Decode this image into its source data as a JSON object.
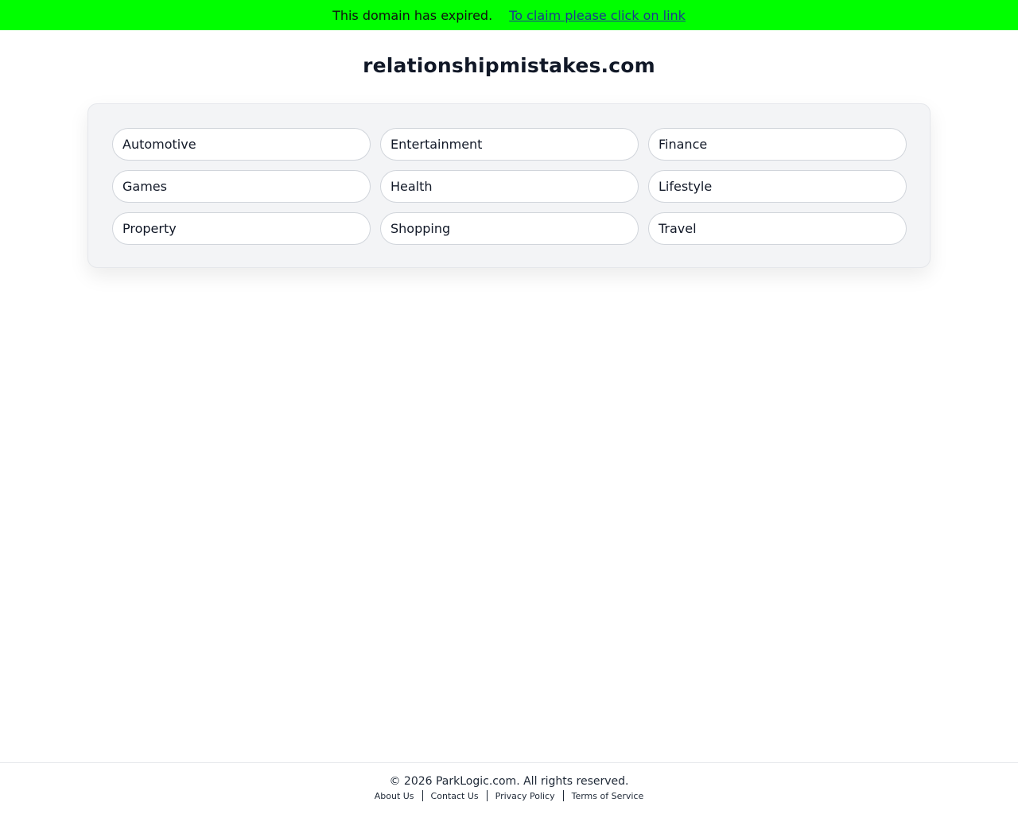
{
  "banner": {
    "message": "This domain has expired.",
    "link_label": "To claim please click on link",
    "background_color": "#00ff00"
  },
  "site": {
    "domain": "relationshipmistakes.com"
  },
  "categories": [
    "Automotive",
    "Entertainment",
    "Finance",
    "Games",
    "Health",
    "Lifestyle",
    "Property",
    "Shopping",
    "Travel"
  ],
  "footer": {
    "copyright": "© 2026 ParkLogic.com. All rights reserved.",
    "links": [
      "About Us",
      "Contact Us",
      "Privacy Policy",
      "Terms of Service"
    ]
  }
}
